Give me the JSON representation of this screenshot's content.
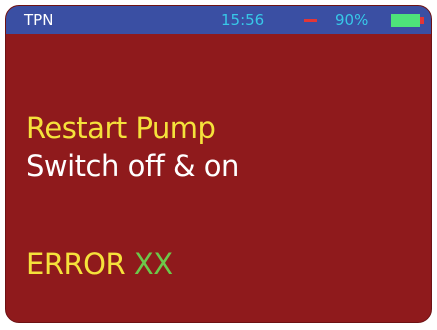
{
  "status_bar": {
    "app_name": "TPN",
    "time": "15:56",
    "separator_icon": "dash-indicator",
    "battery_percent": "90%",
    "battery_icon": "battery-icon"
  },
  "message": {
    "line1": "Restart Pump",
    "line2": "Switch off & on"
  },
  "error": {
    "label": "ERROR",
    "code": "XX"
  },
  "colors": {
    "screen_background": "#8f1a1c",
    "status_bar_background": "#3a4fa3",
    "highlight_text": "#f5e23b",
    "code_text": "#6cc84a",
    "status_text": "#37c8e8"
  }
}
